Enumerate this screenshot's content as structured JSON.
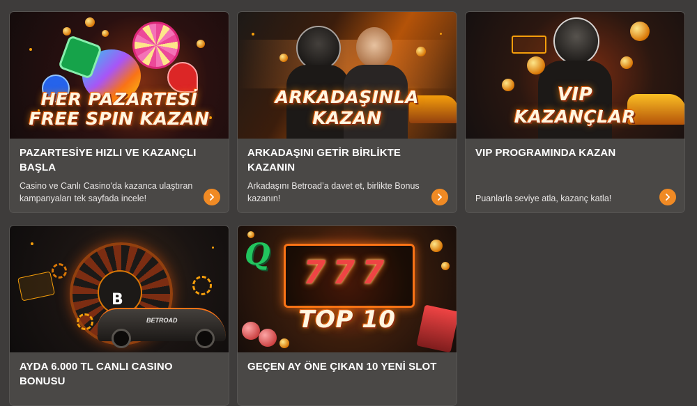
{
  "cards": [
    {
      "banner_lines": [
        "HER PAZARTESİ",
        "FREE SPIN KAZAN"
      ],
      "title": "PAZARTESİYE HIZLI VE KAZANÇLI BAŞLA",
      "description": "Casino ve Canlı Casino'da kazanca ulaştıran kampanyaları tek sayfada incele!"
    },
    {
      "banner_lines": [
        "ARKADAŞINLA",
        "KAZAN"
      ],
      "title": "ARKADAŞINI GETİR BİRLİKTE KAZANIN",
      "description": "Arkadaşını Betroad’a davet et, birlikte Bonus kazanın!"
    },
    {
      "banner_lines": [
        "VIP",
        "KAZANÇLAR"
      ],
      "title": "VIP PROGRAMINDA KAZAN",
      "description": "Puanlarla seviye atla, kazanç katla!"
    },
    {
      "banner_logo": "B",
      "car_plate": "BETROAD",
      "title": "AYDA 6.000 TL CANLI CASINO BONUSU",
      "description": ""
    },
    {
      "banner_lines": [
        "777",
        "TOP 10"
      ],
      "slot_symbol": "Q",
      "title": "GEÇEN AY ÖNE ÇIKAN 10 YENİ SLOT",
      "description": ""
    }
  ],
  "colors": {
    "page_bg": "#3e3c3b",
    "card_bg": "#4a4846",
    "accent": "#f08a24"
  },
  "icons": {
    "arrow": "chevron-right-icon"
  }
}
